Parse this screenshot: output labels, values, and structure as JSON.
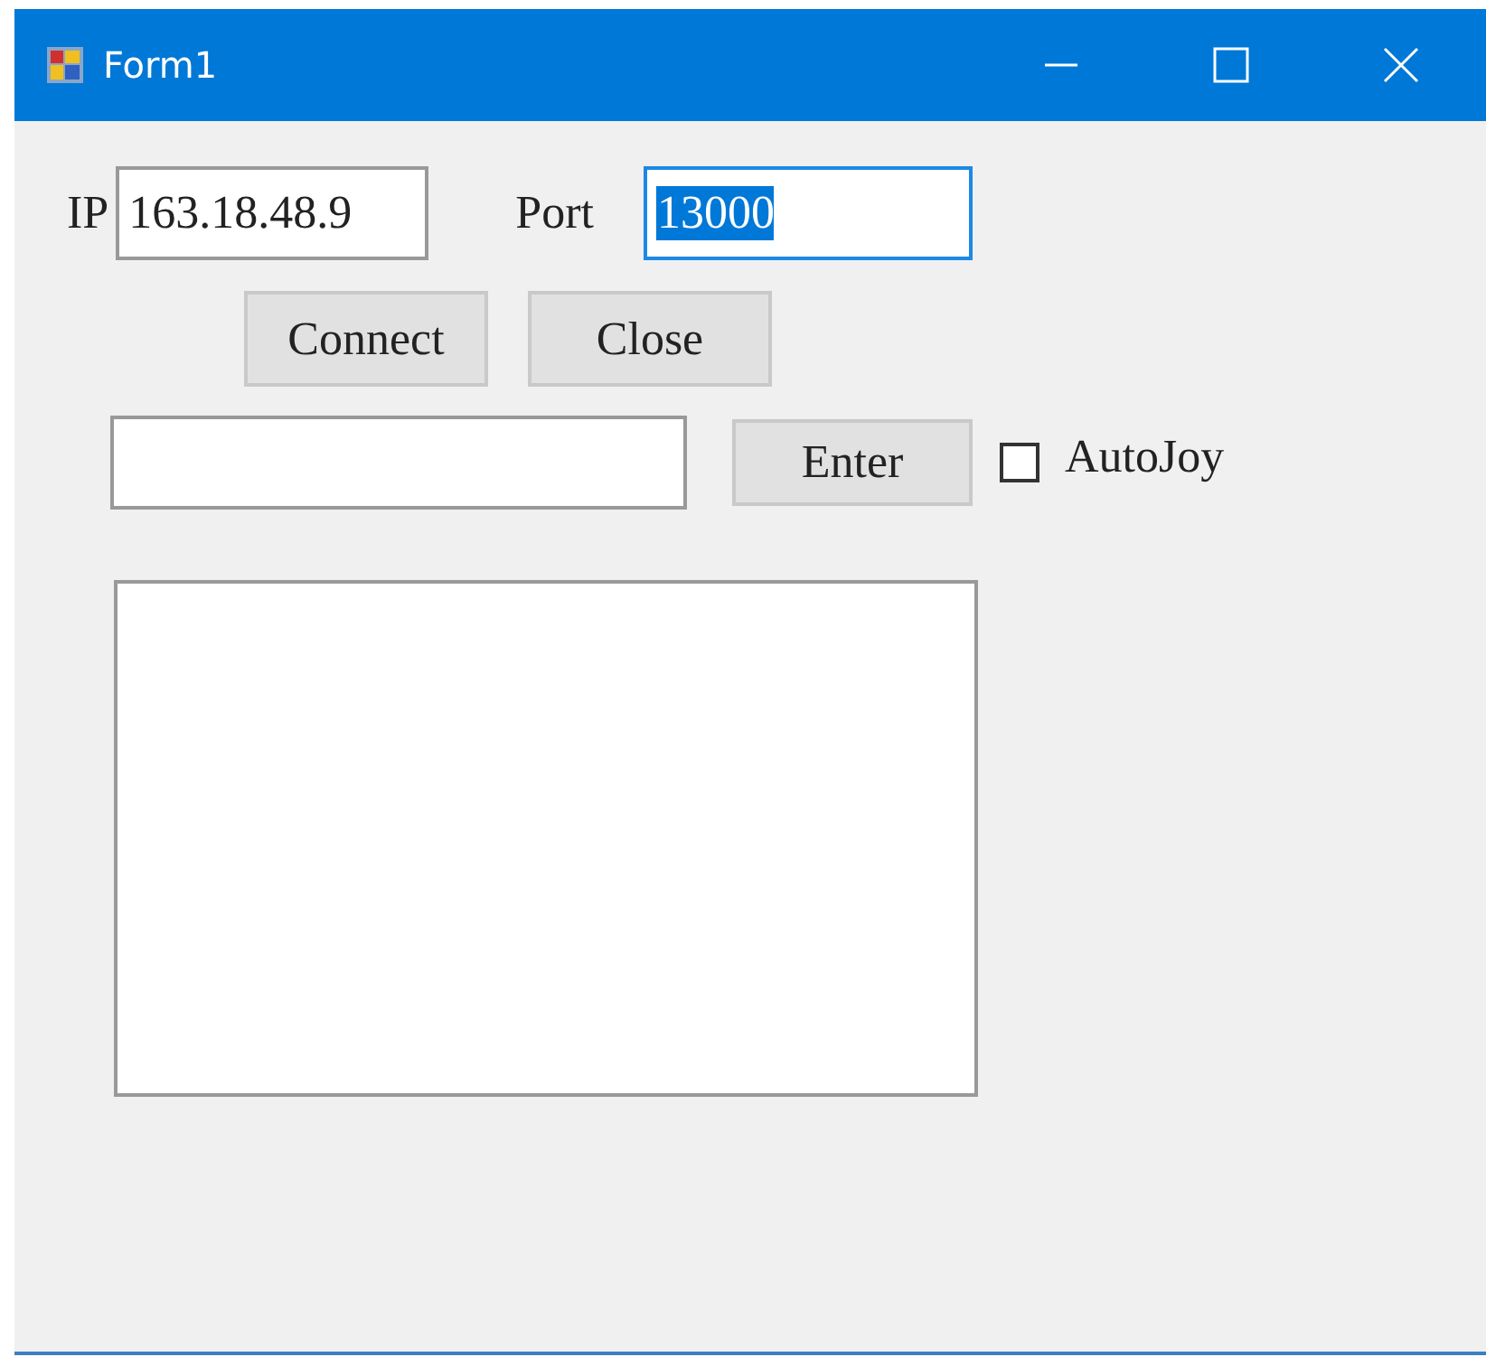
{
  "window": {
    "title": "Form1"
  },
  "ip": {
    "label": "IP",
    "value": "163.18.48.9",
    "focused": false
  },
  "port": {
    "label": "Port",
    "value": "13000",
    "focused": true
  },
  "buttons": [
    "Connect",
    "Close"
  ],
  "command": {
    "focused": false
  },
  "enter_button": "Enter",
  "autojoy": {
    "label": "AutoJoy",
    "checked": false
  }
}
